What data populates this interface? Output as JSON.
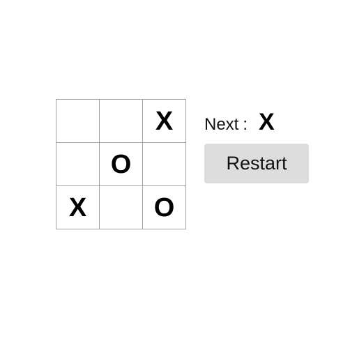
{
  "board": {
    "cells": [
      "",
      "",
      "X",
      "",
      "O",
      "",
      "X",
      "",
      "O"
    ]
  },
  "status": {
    "next_label": "Next",
    "separator": ":",
    "next_player": "X"
  },
  "controls": {
    "restart_label": "Restart"
  },
  "colors": {
    "background": "#ffffff",
    "grid_line": "#a0a0a0",
    "mark": "#000000",
    "button_bg": "#dddddd"
  }
}
